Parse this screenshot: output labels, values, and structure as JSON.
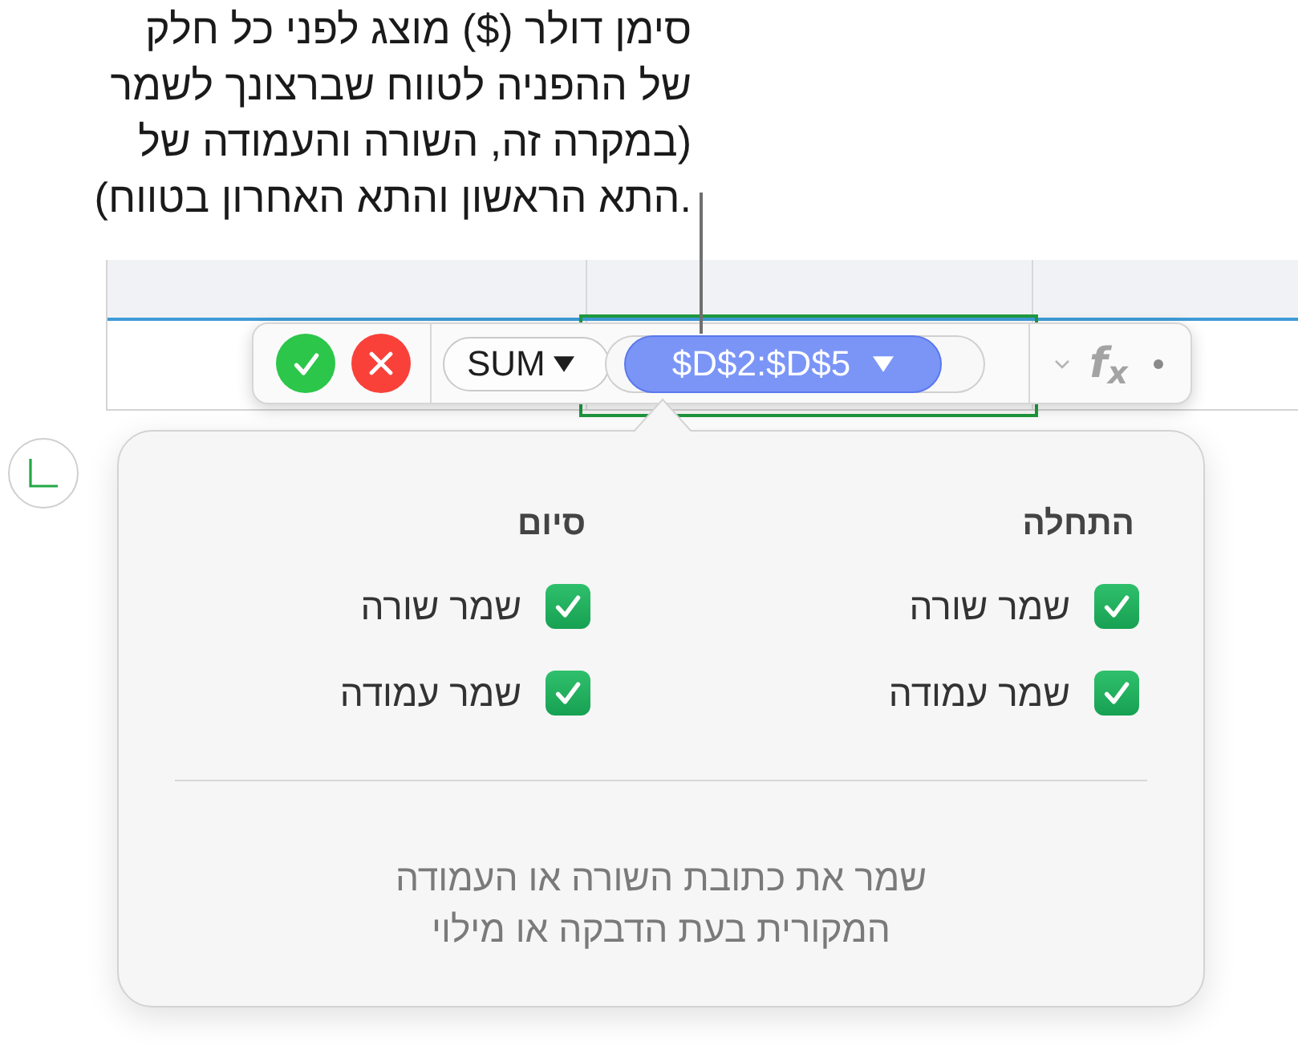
{
  "callout": {
    "lines": [
      "סימן דולר ($) מוצג לפני כל חלק",
      "של ההפניה לטווח שברצונך לשמר",
      "(במקרה זה, השורה והעמודה של",
      ".התא הראשון והתא האחרון בטווח)"
    ]
  },
  "formula_bar": {
    "function": "SUM",
    "range": "$D$2:$D$5",
    "fx": "f$_{x}$"
  },
  "popover": {
    "columns": [
      {
        "heading": "התחלה",
        "options": [
          {
            "label": "שמר שורה",
            "checked": true
          },
          {
            "label": "שמר עמודה",
            "checked": true
          }
        ]
      },
      {
        "heading": "סיום",
        "options": [
          {
            "label": "שמר שורה",
            "checked": true
          },
          {
            "label": "שמר עמודה",
            "checked": true
          }
        ]
      }
    ],
    "note_lines": [
      "שמר את כתובת השורה או העמודה",
      "המקורית בעת הדבקה או מילוי"
    ]
  }
}
